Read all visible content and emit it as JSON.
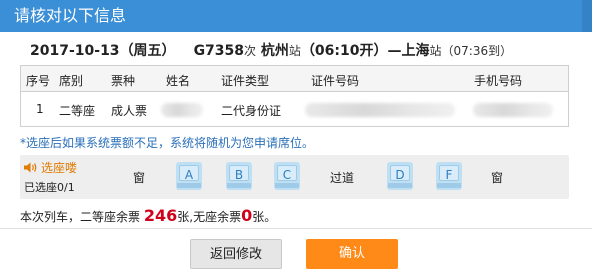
{
  "dialog": {
    "title": "请核对以下信息"
  },
  "train": {
    "date": "2017-10-13",
    "weekday": "（周五）",
    "number": "G7358",
    "number_suffix": "次",
    "from_station": "杭州",
    "station_suffix": "站",
    "depart_time": "（06:10开）",
    "dash": "—",
    "to_station": "上海",
    "arrive_time": "（07:36到）"
  },
  "passengers": {
    "headers": [
      "序号",
      "席别",
      "票种",
      "姓名",
      "证件类型",
      "证件号码",
      "手机号码"
    ],
    "rows": [
      {
        "index": "1",
        "seat_class": "二等座",
        "ticket_type": "成人票",
        "name": "",
        "id_type": "二代身份证",
        "id_number": "",
        "phone": ""
      }
    ]
  },
  "notice": "*选座后如果系统票额不足，系统将随机为您申请席位。",
  "seat_select": {
    "label": "选座喽",
    "selected_count": "已选座0/1",
    "window_label": "窗",
    "aisle_label": "过道",
    "seats": [
      "A",
      "B",
      "C",
      "D",
      "F"
    ],
    "icon": "speaker-icon"
  },
  "availability": {
    "prefix": "本次列车，二等座余票",
    "second_class_count": "246",
    "mid": "张,无座余票",
    "no_seat_count": "0",
    "suffix": "张。"
  },
  "buttons": {
    "back": "返回修改",
    "confirm": "确认"
  },
  "colors": {
    "title_bar": "#3a8fd6",
    "accent_orange": "#ff8a17",
    "count_red": "#d0021b",
    "link_blue": "#2a6fba"
  }
}
